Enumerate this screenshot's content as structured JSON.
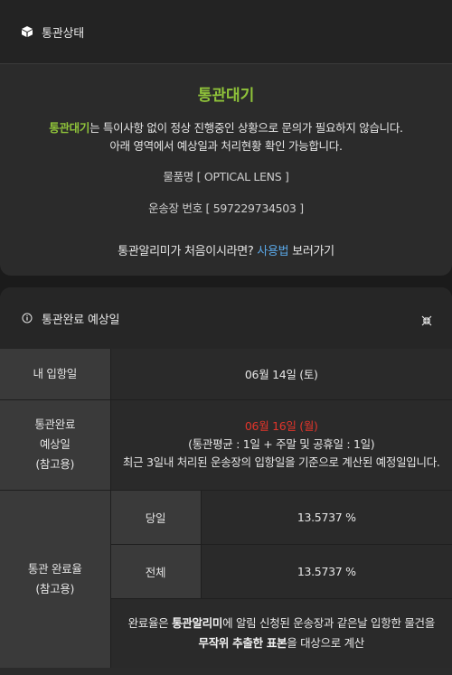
{
  "status_card": {
    "title": "통관상태",
    "status": "통관대기",
    "desc_highlight": "통관대기",
    "desc_rest": "는 특이사항 없이 정상 진행중인 상황으로 문의가 필요하지 않습니다.",
    "desc_line2": "아래 영역에서 예상일과 처리현황 확인 가능합니다.",
    "product": "물품명 [ OPTICAL LENS ]",
    "waybill": "운송장 번호 [ 597229734503 ]",
    "guide_prefix": "통관알리미가 처음이시라면? ",
    "guide_link": "사용법",
    "guide_suffix": " 보러가기"
  },
  "estimate_card": {
    "title": "통관완료 예상일",
    "arrival_label": "내 입항일",
    "arrival_value": "06월 14일 (토)",
    "expected_label_1": "통관완료",
    "expected_label_2": "예상일",
    "expected_label_3": "(참고용)",
    "expected_date": "06월 16일 (월)",
    "expected_detail": "(통관평균 : 1일 + 주말 및 공휴일 : 1일)",
    "expected_note": "최근 3일내 처리된 운송장의 입항일을 기준으로 계산된 예정일입니다.",
    "rate_label_1": "통관 완료율",
    "rate_label_2": "(참고용)",
    "sameday_label": "당일",
    "sameday_value": "13.5737 %",
    "total_label": "전체",
    "total_value": "13.5737 %",
    "rate_note_1a": "완료율은 ",
    "rate_note_1b": "통관알리미",
    "rate_note_1c": "에 알림 신청된 운송장과 같은날 입항한 물건을",
    "rate_note_2a": "무작위 추출한 표본",
    "rate_note_2b": "을 대상으로 계산"
  },
  "colors": {
    "accent_green": "#8fc33a",
    "link_blue": "#5aa7e6",
    "alert_red": "#e0352b"
  },
  "icons": [
    "box-icon",
    "info-icon",
    "collapse-icon"
  ]
}
